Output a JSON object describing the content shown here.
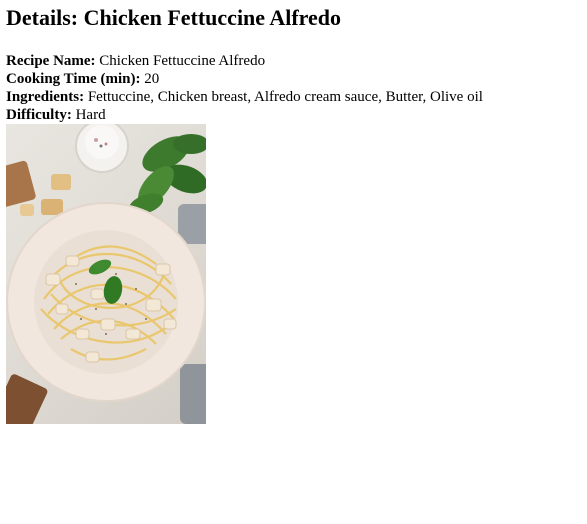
{
  "page": {
    "title": "Details: Chicken Fettuccine Alfredo"
  },
  "details": [
    {
      "label": "Recipe Name:",
      "value": "Chicken Fettuccine Alfredo"
    },
    {
      "label": "Cooking Time (min):",
      "value": "20"
    },
    {
      "label": "Ingredients:",
      "value": "Fettuccine, Chicken breast, Alfredo cream sauce, Butter, Olive oil"
    },
    {
      "label": "Difficulty:",
      "value": "Hard"
    }
  ],
  "image": {
    "subject": "plate-of-chicken-fettuccine-alfredo"
  }
}
